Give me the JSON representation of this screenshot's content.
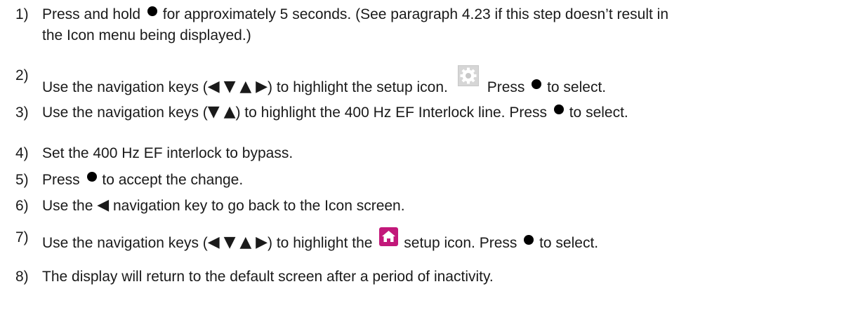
{
  "steps": [
    {
      "num": "1)",
      "p1": "Press and hold",
      "p2": "for approximately 5 seconds. (See paragraph 4.23 if this step doesn’t result in",
      "line2": "the Icon menu being displayed.)"
    },
    {
      "num": "2)",
      "p1": "Use the navigation keys (",
      "p2": ") to highlight the setup icon.",
      "p3": "Press",
      "p4": "to select."
    },
    {
      "num": "3)",
      "p1": "Use the navigation keys (",
      "p2": ") to highlight the 400 Hz EF Interlock line. Press",
      "p3": "to select."
    },
    {
      "num": "4)",
      "p1": "Set the 400 Hz EF interlock to bypass."
    },
    {
      "num": "5)",
      "p1": "Press",
      "p2": "to accept the change."
    },
    {
      "num": "6)",
      "p1": "Use the",
      "p2": "navigation key to go back to the Icon screen."
    },
    {
      "num": "7)",
      "p1": "Use the navigation keys (",
      "p2": ") to highlight the",
      "p3": "setup icon. Press",
      "p4": "to select."
    },
    {
      "num": "8)",
      "p1": "The display will return to the default screen after a period of inactivity."
    }
  ],
  "icons": {
    "select_key": "filled-circle-icon",
    "left_key": "left-triangle-icon",
    "down_key": "down-triangle-icon",
    "up_key": "up-triangle-icon",
    "right_key": "right-triangle-icon",
    "setup": "gear-icon",
    "home": "home-icon"
  },
  "colors": {
    "text": "#1a1a1a",
    "gear_bg": "#c8c8c8",
    "home_bg": "#c2187a"
  }
}
